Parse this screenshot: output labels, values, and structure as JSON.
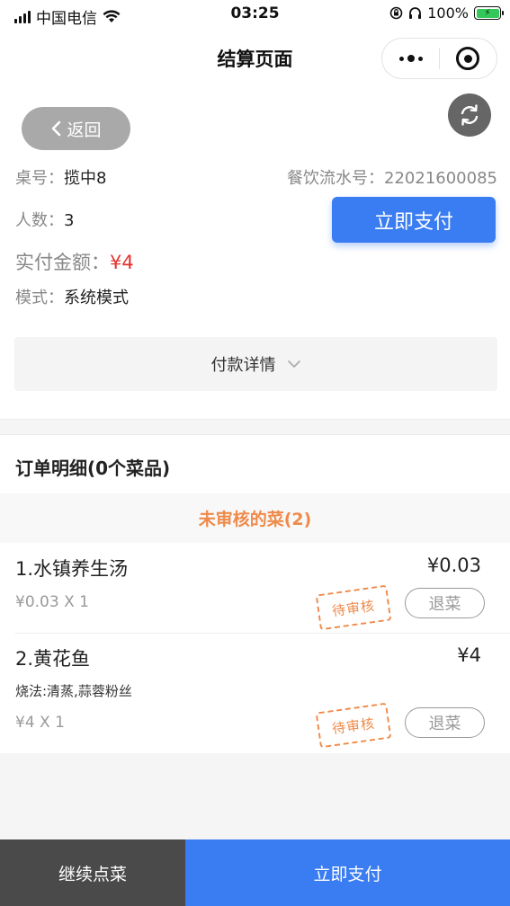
{
  "status_bar": {
    "carrier": "中国电信",
    "time": "03:25",
    "battery": "100%"
  },
  "nav": {
    "title": "结算页面"
  },
  "header": {
    "back_label": "返回",
    "table_label": "桌号：",
    "table_value": "揽中8",
    "serial_label": "餐饮流水号：",
    "serial_value": "22021600085",
    "people_label": "人数：",
    "people_value": "3",
    "amount_label": "实付金额：",
    "amount_value": "¥4",
    "mode_label": "模式：",
    "mode_value": "系统模式",
    "pay_now_label": "立即支付"
  },
  "payment_details": {
    "label": "付款详情"
  },
  "order": {
    "title": "订单明细(0个菜品)",
    "section_title": "未审核的菜(2)",
    "items": [
      {
        "name": "1.水镇养生汤",
        "price": "¥0.03",
        "unit": "¥0.03 X 1",
        "method": "",
        "stamp": "待审核",
        "refund_label": "退菜"
      },
      {
        "name": "2.黄花鱼",
        "price": "¥4",
        "unit": "¥4 X 1",
        "method": "烧法:清蒸,蒜蓉粉丝",
        "stamp": "待审核",
        "refund_label": "退菜"
      }
    ]
  },
  "bottom_bar": {
    "continue_label": "继续点菜",
    "pay_label": "立即支付"
  },
  "colors": {
    "primary": "#3a7cf2",
    "accent_orange": "#ef8a4a",
    "amount_red": "#e5322d",
    "dark_button": "#4a4a4a"
  }
}
